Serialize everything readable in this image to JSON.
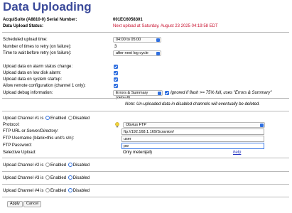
{
  "page": {
    "title": "Data Uploading"
  },
  "header": {
    "serial_label": "AcquiSuite (A8810-0) Serial Number:",
    "serial_value": "001EC6058301",
    "status_label": "Data Upload Status:",
    "status_value": "Next upload at Saturday, August 23 2025 04:19:58 EDT"
  },
  "schedule": {
    "time_label": "Scheduled upload time:",
    "time_value": "04:00 to 05:00",
    "retries_label": "Number of times to retry (on failure):",
    "retries_value": "3",
    "wait_label": "Time to wait before retry (on failure):",
    "wait_value": "after next log cycle"
  },
  "options": {
    "alarm_label": "Upload data on alarm status change:",
    "lowdisk_label": "Upload data on low disk alarm:",
    "startup_label": "Upload data on system startup:",
    "remote_label": "Allow remote configuration (channel 1 only):",
    "debug_label": "Upload debug information:",
    "debug_value": "Errors & Summary (default)",
    "debug_note": "Ignored if flash >= 75% full, uses \"Errors & Summary\""
  },
  "note": "Note: Un-uploaded data in disabled channels will eventually be deleted.",
  "channel1": {
    "label": "Upload Channel #1 is",
    "enabled_label": "Enabled",
    "disabled_label": "Disabled",
    "protocol_label": "Protocol:",
    "protocol_value": "Obvius FTP",
    "ftp_url_label": "FTP URL or Server/Directory:",
    "ftp_url_value": "ftp://192.168.1.169/Scranton/",
    "username_label": "FTP Username (blank=this unit's s/n):",
    "username_value": "user",
    "password_label": "FTP Password:",
    "password_value": "pw",
    "selective_label": "Selective Upload:",
    "only_meters_label": "Only meters:",
    "only_meters_value": "(all)",
    "help_label": "help"
  },
  "channel2": {
    "label": "Upload Channel #2 is",
    "enabled_label": "Enabled",
    "disabled_label": "Disabled"
  },
  "channel3": {
    "label": "Upload Channel #3 is",
    "enabled_label": "Enabled",
    "disabled_label": "Disabled"
  },
  "channel4": {
    "label": "Upload Channel #4 is",
    "enabled_label": "Enabled",
    "disabled_label": "Disabled"
  },
  "buttons": {
    "apply": "Apply",
    "cancel": "Cancel"
  },
  "colors": {
    "title": "#3b4a9a",
    "status": "#c8102e",
    "control": "#2f6fe0"
  }
}
